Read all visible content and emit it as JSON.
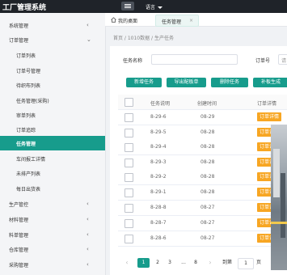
{
  "app": {
    "title": "工厂管理系统",
    "language_label": "语言"
  },
  "sidebar": {
    "items": [
      {
        "label": "系统管理",
        "chevron": "‹"
      },
      {
        "label": "订单管理",
        "chevron": "⌄"
      },
      {
        "label": "订单列表"
      },
      {
        "label": "订单号管理"
      },
      {
        "label": "待织布列表"
      },
      {
        "label": "任务管理(采购)"
      },
      {
        "label": "审单列表"
      },
      {
        "label": "订单追踪"
      },
      {
        "label": "任务管理"
      },
      {
        "label": "车间报工详情"
      },
      {
        "label": "未排产列表"
      },
      {
        "label": "每日出货表"
      },
      {
        "label": "生产管控",
        "chevron": "‹"
      },
      {
        "label": "材料管理",
        "chevron": "‹"
      },
      {
        "label": "料单管理",
        "chevron": "‹"
      },
      {
        "label": "仓库管理",
        "chevron": "‹"
      },
      {
        "label": "采购管理",
        "chevron": "‹"
      }
    ],
    "active_index": 8
  },
  "tabs": {
    "home": "我的桌面",
    "task": "任务管理",
    "close": "×"
  },
  "breadcrumb": "首页 / 1010数据 / 生产任务",
  "filters": {
    "task_name_label": "任务名称",
    "order_no_label": "订单号",
    "order_no_value": "请"
  },
  "toolbar": {
    "add": "新增任务",
    "import": "导出配板单",
    "delete": "删除任务",
    "generate": "补板生成"
  },
  "table": {
    "columns": [
      "任务说明",
      "创建时间",
      "订单详情"
    ],
    "tag_label": "订单详情",
    "rows": [
      {
        "desc": "8-29-6",
        "time": "08-29"
      },
      {
        "desc": "8-29-5",
        "time": "08-28"
      },
      {
        "desc": "8-29-4",
        "time": "08-28"
      },
      {
        "desc": "8-29-3",
        "time": "08-28"
      },
      {
        "desc": "8-29-2",
        "time": "08-28"
      },
      {
        "desc": "8-29-1",
        "time": "08-28"
      },
      {
        "desc": "8-28-8",
        "time": "08-27"
      },
      {
        "desc": "8-28-7",
        "time": "08-27"
      },
      {
        "desc": "8-28-6",
        "time": "08-27"
      }
    ]
  },
  "pager": {
    "prev": "‹",
    "pages": [
      "1",
      "2",
      "3",
      "...",
      "8"
    ],
    "next": "›",
    "goto_label": "到第",
    "goto_value": "1",
    "page_unit": "页"
  },
  "colors": {
    "accent": "#179c8c",
    "tag": "#f7a623",
    "topbar": "#1f2329"
  }
}
